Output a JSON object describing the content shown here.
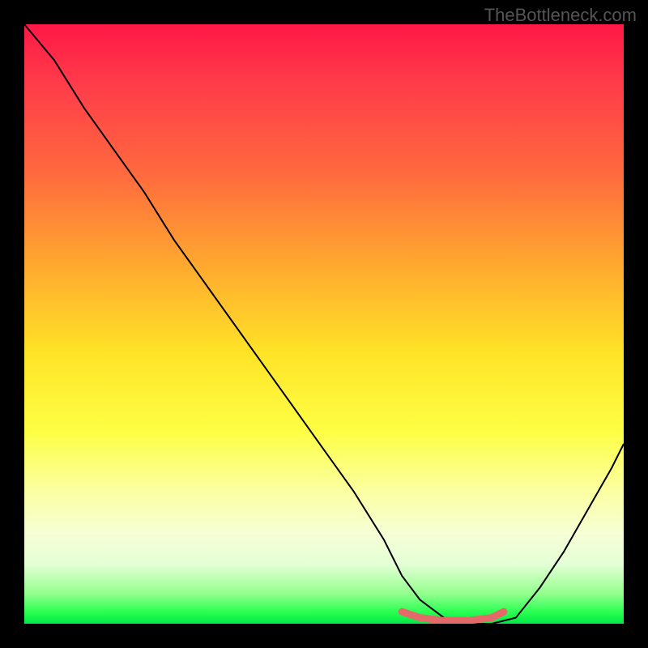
{
  "watermark": "TheBottleneck.com",
  "chart_data": {
    "type": "line",
    "title": "",
    "xlabel": "",
    "ylabel": "",
    "xlim": [
      0,
      100
    ],
    "ylim": [
      0,
      100
    ],
    "gradient_meaning": "bottleneck severity (red=high, green=low)",
    "series": [
      {
        "name": "bottleneck-curve",
        "color": "#000000",
        "x": [
          0,
          5,
          10,
          15,
          20,
          25,
          30,
          35,
          40,
          45,
          50,
          55,
          60,
          63,
          66,
          70,
          74,
          78,
          82,
          86,
          90,
          94,
          98,
          100
        ],
        "y": [
          100,
          94,
          86,
          79,
          72,
          64,
          57,
          50,
          43,
          36,
          29,
          22,
          14,
          8,
          4,
          1,
          0,
          0,
          1,
          6,
          12,
          19,
          26,
          30
        ]
      },
      {
        "name": "optimal-band",
        "color": "#e46a6a",
        "x": [
          63,
          66,
          70,
          74,
          78,
          80
        ],
        "y": [
          2,
          1,
          0.5,
          0.5,
          1,
          2
        ]
      }
    ],
    "optimal_range_x": [
      63,
      80
    ]
  }
}
